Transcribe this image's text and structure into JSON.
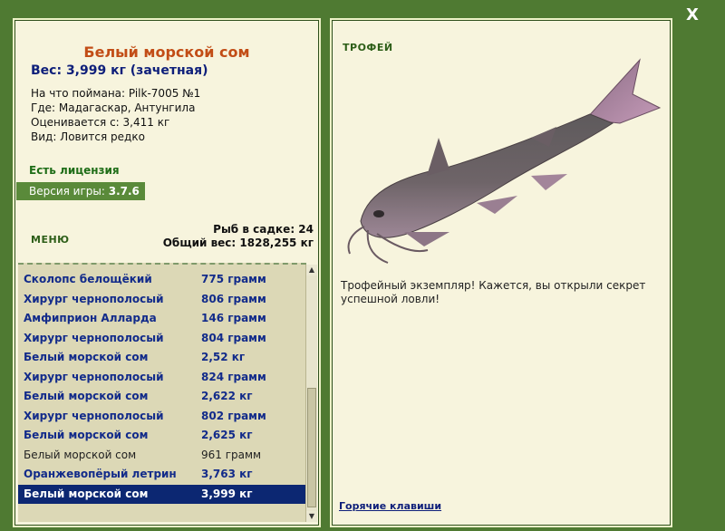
{
  "window": {
    "close_label": "X"
  },
  "fish": {
    "title": "Белый морской сом",
    "weight": "Вес: 3,999 кг (зачетная)",
    "caught_with": "На что поймана: Pilk-7005 №1",
    "where": "Где: Мадагаскар, Антунгила",
    "valued_from": "Оценивается с: 3,411 кг",
    "kind": "Вид: Ловится редко"
  },
  "license": "Есть лицензия",
  "version": {
    "label": "Версия игры: ",
    "value": "3.7.6"
  },
  "menu_label": "МЕНЮ",
  "cage": {
    "count": "Рыб в садке: 24",
    "total": "Общий вес: 1828,255 кг"
  },
  "catch_list": [
    {
      "name": "Сколопс белощёкий",
      "weight": "775 грамм",
      "style": "bold"
    },
    {
      "name": "Хирург чернополосый",
      "weight": "806 грамм",
      "style": "bold"
    },
    {
      "name": "Амфиприон Алларда",
      "weight": "146 грамм",
      "style": "bold"
    },
    {
      "name": "Хирург чернополосый",
      "weight": "804 грамм",
      "style": "bold"
    },
    {
      "name": "Белый морской сом",
      "weight": "2,52 кг",
      "style": "bold"
    },
    {
      "name": "Хирург чернополосый",
      "weight": "824 грамм",
      "style": "bold"
    },
    {
      "name": "Белый морской сом",
      "weight": "2,622 кг",
      "style": "bold"
    },
    {
      "name": "Хирург чернополосый",
      "weight": "802 грамм",
      "style": "bold"
    },
    {
      "name": "Белый морской сом",
      "weight": "2,625 кг",
      "style": "bold"
    },
    {
      "name": "Белый морской сом",
      "weight": "961 грамм",
      "style": "plain"
    },
    {
      "name": "Оранжевопёрый летрин",
      "weight": "3,763 кг",
      "style": "bold"
    },
    {
      "name": "Белый морской сом",
      "weight": "3,999 кг",
      "style": "selected"
    }
  ],
  "trophy": {
    "label": "ТРОФЕЙ",
    "description": "Трофейный экземпляр! Кажется, вы открыли секрет успешной ловли!",
    "hotkeys_label": "Горячие клавиши"
  },
  "icons": {
    "close": "close-icon",
    "fish": "catfish-image",
    "scroll_up": "arrow-up-icon",
    "scroll_down": "arrow-down-icon"
  },
  "colors": {
    "frame": "#4f7a32",
    "panel": "#f7f4dd",
    "title": "#c24d16",
    "link": "#0e1f7a",
    "selected": "#0c2772"
  }
}
